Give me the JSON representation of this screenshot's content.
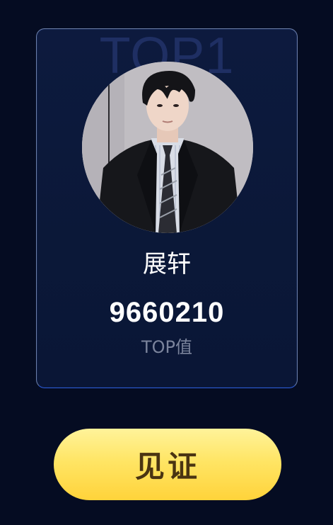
{
  "card": {
    "rank_watermark": "TOP1",
    "name": "展轩",
    "score": "9660210",
    "score_label": "TOP值"
  },
  "action": {
    "button_label": "见证"
  },
  "colors": {
    "background": "#050c22",
    "card_background": "#0b1838",
    "button_yellow": "#ffe066",
    "button_text": "#4a3412"
  }
}
